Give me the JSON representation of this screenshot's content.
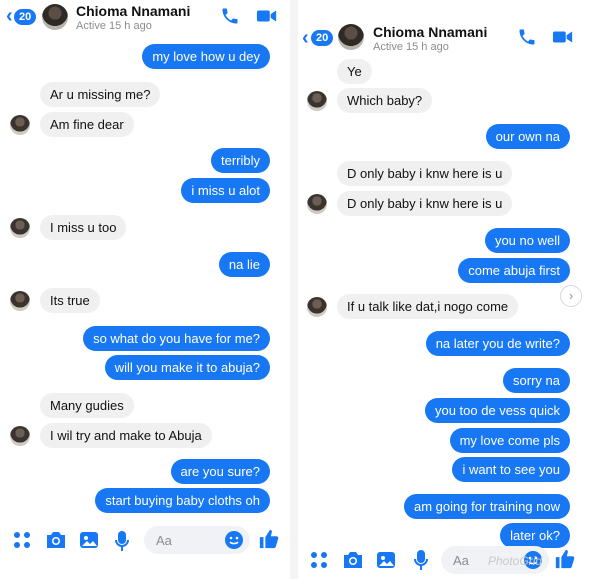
{
  "left": {
    "header": {
      "back_count": "20",
      "name": "Chioma Nnamani",
      "status": "Active 15 h ago"
    },
    "messages": [
      {
        "text": "my love how u dey",
        "dir": "out"
      },
      {
        "text": "Ar u missing me?",
        "dir": "in"
      },
      {
        "text": "Am fine dear",
        "dir": "in"
      },
      {
        "text": "terribly",
        "dir": "out"
      },
      {
        "text": "i miss u alot",
        "dir": "out"
      },
      {
        "text": "I miss u too",
        "dir": "in"
      },
      {
        "text": "na lie",
        "dir": "out"
      },
      {
        "text": "Its true",
        "dir": "in"
      },
      {
        "text": "so what do you have for me?",
        "dir": "out"
      },
      {
        "text": "will you make it to abuja?",
        "dir": "out"
      },
      {
        "text": "Many gudies",
        "dir": "in"
      },
      {
        "text": "I wil try and make to Abuja",
        "dir": "in"
      },
      {
        "text": "are you sure?",
        "dir": "out"
      },
      {
        "text": "start buying baby cloths oh",
        "dir": "out"
      }
    ],
    "composer_placeholder": "Aa"
  },
  "right": {
    "header": {
      "back_count": "20",
      "name": "Chioma Nnamani",
      "status": "Active 15 h ago"
    },
    "messages": [
      {
        "text": "Ye",
        "dir": "in"
      },
      {
        "text": "Which baby?",
        "dir": "in"
      },
      {
        "text": "our own na",
        "dir": "out"
      },
      {
        "text": "D only baby i knw here is u",
        "dir": "in"
      },
      {
        "text": "D only baby i knw here is u",
        "dir": "in"
      },
      {
        "text": "you no well",
        "dir": "out"
      },
      {
        "text": "come abuja first",
        "dir": "out"
      },
      {
        "text": "If u talk like dat,i nogo come",
        "dir": "in"
      },
      {
        "text": "na later you de write?",
        "dir": "out"
      },
      {
        "text": "sorry na",
        "dir": "out"
      },
      {
        "text": "you too de vess quick",
        "dir": "out"
      },
      {
        "text": "my love come pls",
        "dir": "out"
      },
      {
        "text": "i want to see you",
        "dir": "out"
      },
      {
        "text": "am going for training now",
        "dir": "out"
      },
      {
        "text": "later ok?",
        "dir": "out"
      }
    ],
    "composer_placeholder": "Aa",
    "watermark": "PhotoGrid"
  },
  "icons": {
    "back": "chevron-left-icon",
    "call": "phone-icon",
    "video": "video-camera-icon",
    "apps": "four-dots-icon",
    "camera": "camera-icon",
    "gallery": "image-icon",
    "mic": "microphone-icon",
    "emoji": "smiley-icon",
    "like": "thumbs-up-icon",
    "scroll": "chevron-right-icon"
  },
  "colors": {
    "accent": "#1877f2",
    "incoming_bubble": "#f0f0f0",
    "outgoing_text": "#ffffff"
  }
}
